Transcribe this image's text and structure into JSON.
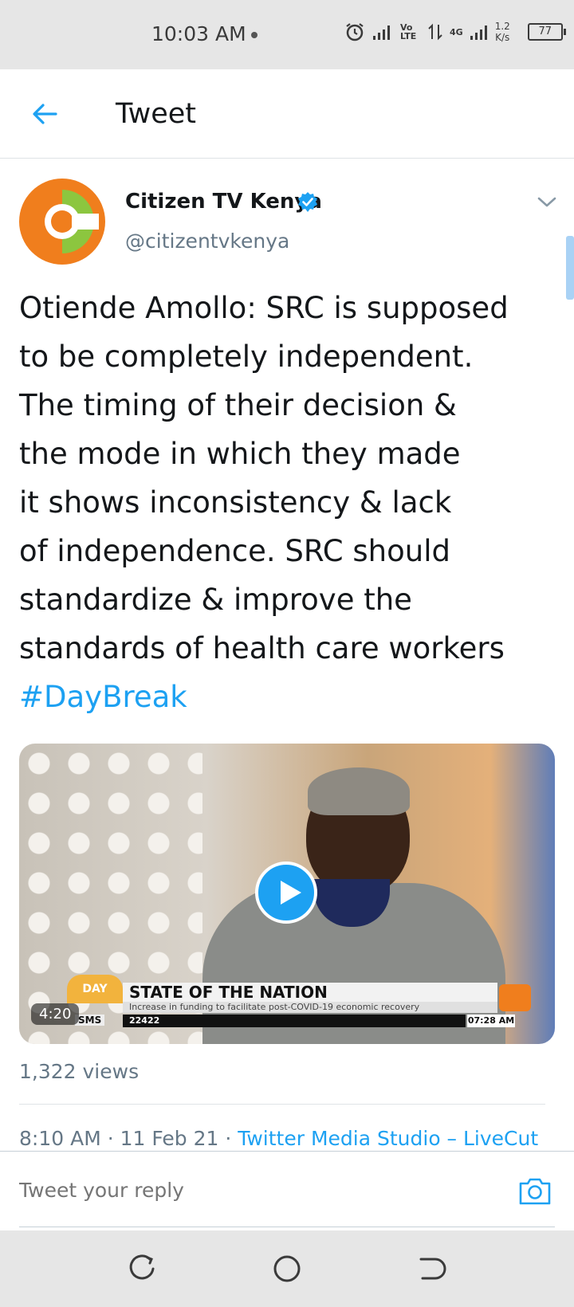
{
  "status_bar": {
    "time": "10:03 AM",
    "net_volte": "Vo LTE",
    "net_gen": "4G",
    "speed_value": "1.2",
    "speed_unit": "K/s",
    "battery": "77"
  },
  "header": {
    "title": "Tweet"
  },
  "tweet": {
    "display_name": "Citizen TV Kenya",
    "handle": "@citizentvkenya",
    "text": "Otiende Amollo: SRC is supposed\nto be completely independent.\nThe timing of their decision &\nthe mode in which they made\nit shows inconsistency & lack\nof independence. SRC should\nstandardize & improve the\nstandards of health care workers",
    "hashtag": "#DayBreak",
    "video": {
      "duration": "4:20",
      "lower_third_title": "STATE OF THE NATION",
      "lower_third_subtitle": "Increase in funding to facilitate post-COVID-19 economic recovery",
      "sms_label": "SMS",
      "sms_number": "22422",
      "clock": "07:28 AM",
      "show_logo": "DAY"
    },
    "views": "1,322 views",
    "timestamp": "8:10 AM · 11 Feb 21 · ",
    "source": "Twitter Media Studio – LiveCut"
  },
  "reply": {
    "placeholder": "Tweet your reply"
  },
  "colors": {
    "accent": "#1da1f2",
    "muted": "#657786",
    "brand_orange": "#f07e1d",
    "brand_green": "#8cc63f"
  },
  "icons": {
    "back": "arrow-left-icon",
    "verified": "verified-badge-icon",
    "more": "chevron-down-icon",
    "play": "play-icon",
    "camera": "camera-icon"
  }
}
